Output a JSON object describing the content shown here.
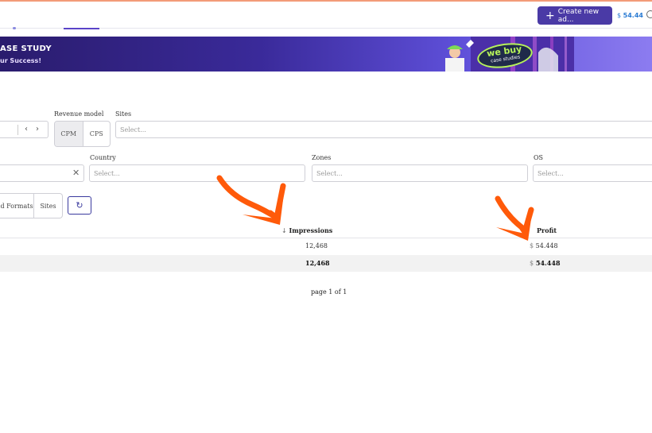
{
  "topbar": {
    "create_button_label": "Create new ad...",
    "balance_currency": "$",
    "balance_value": "54.44"
  },
  "banner": {
    "title": "ASE STUDY",
    "subtitle": "ur Success!",
    "sign_line1": "we buy",
    "sign_line2": "case studies"
  },
  "filters": {
    "revenue_model_label": "Revenue model",
    "revenue_model_options": [
      "CPM",
      "CPS"
    ],
    "sites_label": "Sites",
    "sites_placeholder": "Select...",
    "country_label": "Country",
    "country_placeholder": "Select...",
    "zones_label": "Zones",
    "zones_placeholder": "Select...",
    "os_label": "OS",
    "os_placeholder": "Select..."
  },
  "groupby": {
    "tabs": [
      "d Formats",
      "Sites"
    ]
  },
  "table": {
    "columns": {
      "impressions": "Impressions",
      "profit": "Profit"
    },
    "rows": [
      {
        "impressions": "12,468",
        "profit_currency": "$",
        "profit": "54.448"
      }
    ],
    "total": {
      "impressions": "12,468",
      "profit_currency": "$",
      "profit": "54.448"
    }
  },
  "pagination": {
    "text": "page 1 of 1"
  },
  "colors": {
    "accent": "#4a3aa6",
    "annotation_arrow": "#ff5a0a"
  },
  "icons": [
    "plus-icon",
    "chevron-left-icon",
    "chevron-right-icon",
    "clear-icon",
    "refresh-icon",
    "sort-arrow-down-icon"
  ]
}
